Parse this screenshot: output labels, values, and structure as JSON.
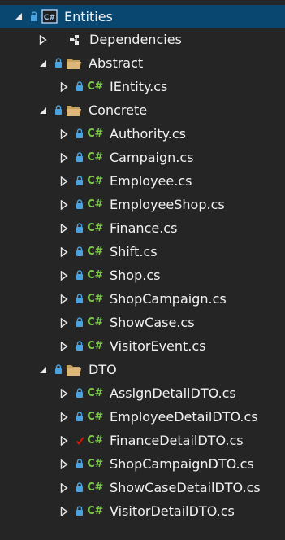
{
  "colors": {
    "background": "#252526",
    "selection": "#094771",
    "text": "#f1f1f1",
    "csharp_green": "#7ec94b",
    "folder_yellow": "#dcb67a",
    "lock_blue": "#4aa3df",
    "check_red": "#e51400"
  },
  "tree": {
    "root": {
      "label": "Entities",
      "icon": "csharp-project-icon"
    },
    "dependencies": {
      "label": "Dependencies",
      "icon": "dependencies-icon"
    },
    "abstract": {
      "label": "Abstract",
      "files": [
        {
          "label": "IEntity.cs"
        }
      ]
    },
    "concrete": {
      "label": "Concrete",
      "files": [
        {
          "label": "Authority.cs"
        },
        {
          "label": "Campaign.cs"
        },
        {
          "label": "Employee.cs"
        },
        {
          "label": "EmployeeShop.cs"
        },
        {
          "label": "Finance.cs"
        },
        {
          "label": "Shift.cs"
        },
        {
          "label": "Shop.cs"
        },
        {
          "label": "ShopCampaign.cs"
        },
        {
          "label": "ShowCase.cs"
        },
        {
          "label": "VisitorEvent.cs"
        }
      ]
    },
    "dto": {
      "label": "DTO",
      "files": [
        {
          "label": "AssignDetailDTO.cs"
        },
        {
          "label": "EmployeeDetailDTO.cs"
        },
        {
          "label": "FinanceDetailDTO.cs"
        },
        {
          "label": "ShopCampaignDTO.cs"
        },
        {
          "label": "ShowCaseDetailDTO.cs"
        },
        {
          "label": "VisitorDetailDTO.cs"
        }
      ]
    }
  }
}
